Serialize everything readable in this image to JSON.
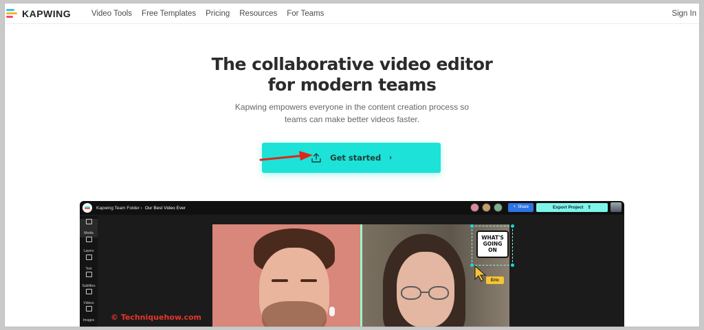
{
  "nav": {
    "brand": "KAPWING",
    "links": [
      "Video Tools",
      "Free Templates",
      "Pricing",
      "Resources",
      "For Teams"
    ],
    "sign_in": "Sign In"
  },
  "hero": {
    "title_line1": "The collaborative video editor",
    "title_line2": "for modern teams",
    "subtitle_line1": "Kapwing empowers everyone in the content creation process so",
    "subtitle_line2": "teams can make better videos faster.",
    "cta_label": "Get started",
    "cta_chevron": "›"
  },
  "editor": {
    "folder": "Kapwing Team Folder ›",
    "project": "Our Best Video Ever",
    "share_label": "Share",
    "export_label": "Export Project",
    "sidebar": [
      "Media",
      "Layers",
      "Text",
      "Subtitles",
      "Videos",
      "Images"
    ],
    "sticker_text": [
      "WHAT'S",
      "GOING",
      "ON"
    ],
    "cursor_name": "Eric"
  },
  "watermark": "© Techniquehow.com",
  "colors": {
    "cta": "#1de2d8",
    "annotation_arrow": "#e3241b",
    "share": "#2d74e4",
    "export": "#7df5ea"
  },
  "icons": {
    "cta": "upload-icon",
    "annotation": "red-arrow-icon",
    "cursor": "pointer-cursor-icon"
  }
}
